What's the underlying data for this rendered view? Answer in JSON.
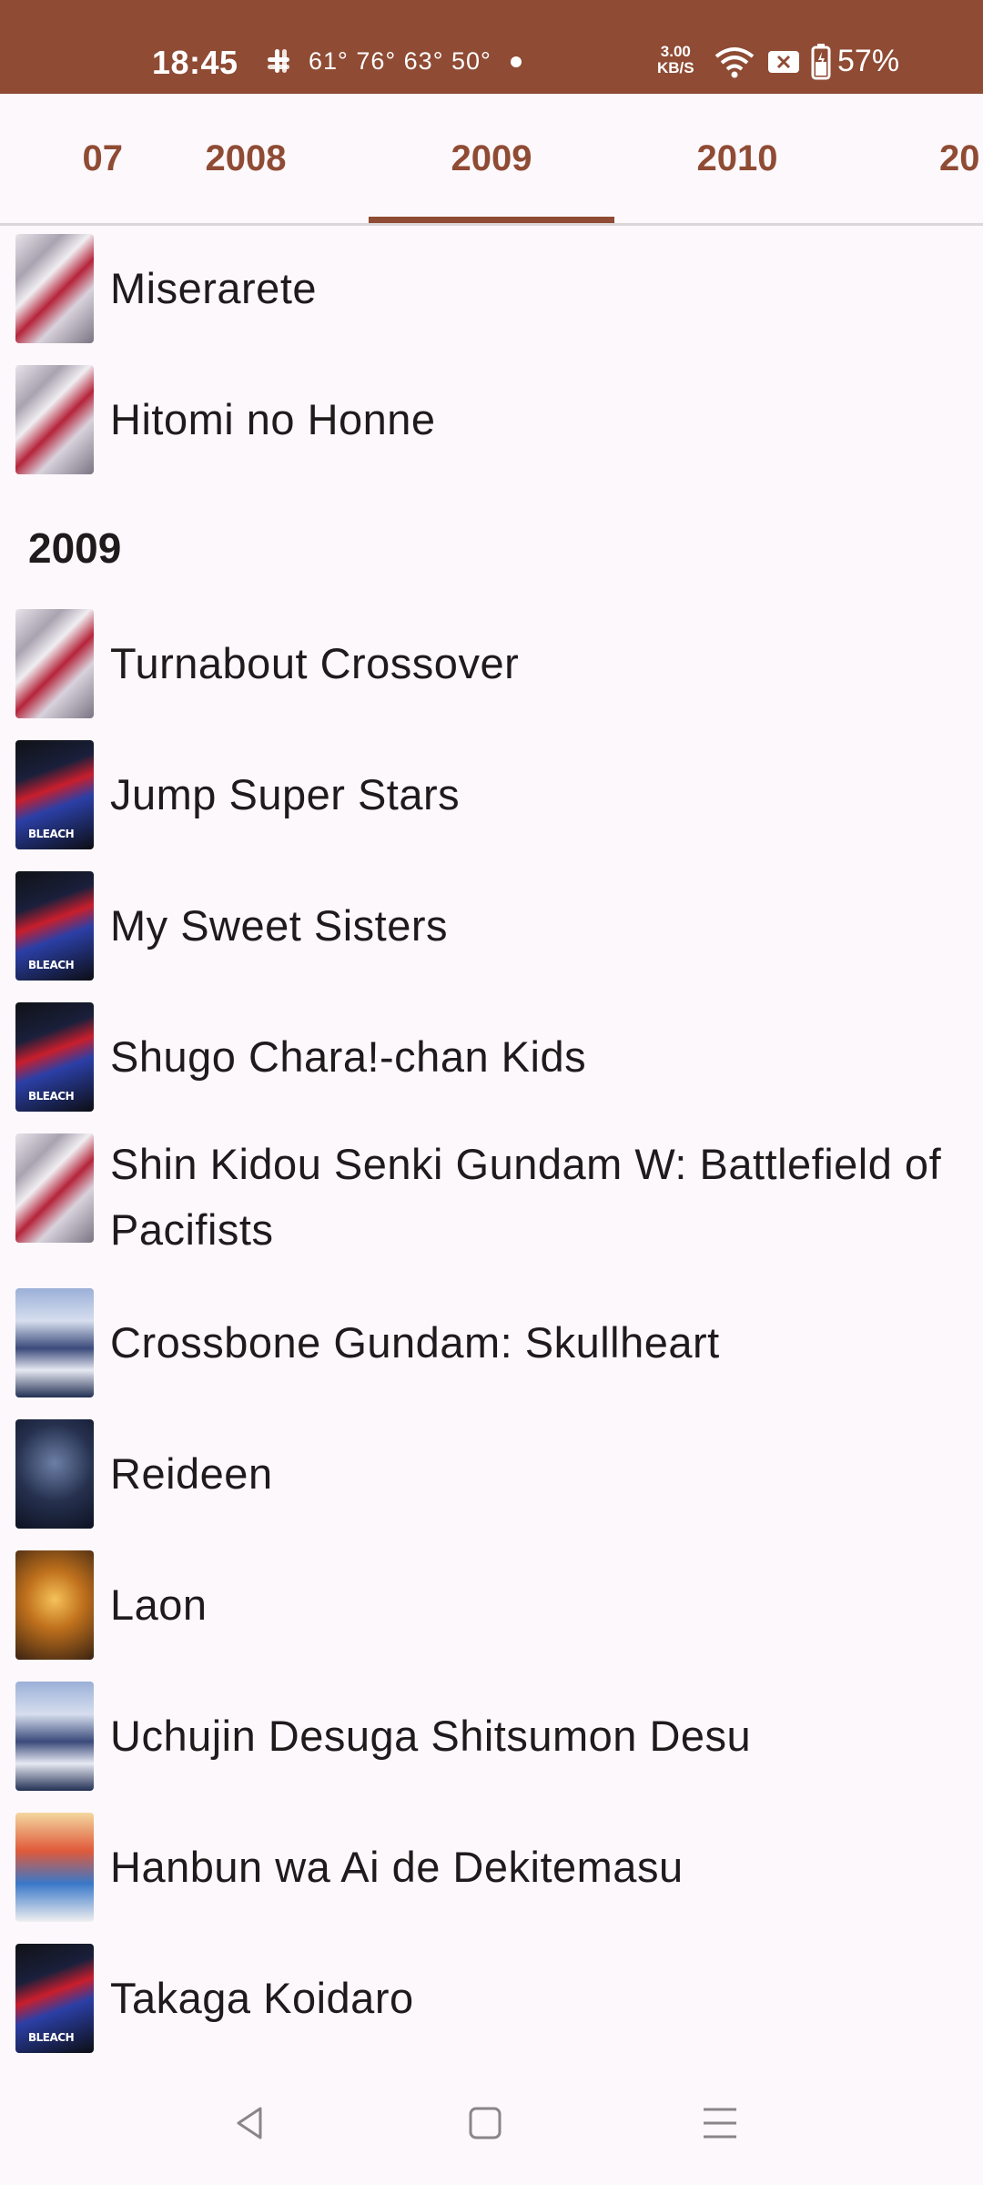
{
  "status_bar": {
    "time": "18:45",
    "temps": "61° 76° 63° 50°",
    "speed_value": "3.00",
    "speed_unit": "KB/S",
    "battery": "57%"
  },
  "tabs": [
    {
      "label": "07"
    },
    {
      "label": "2008"
    },
    {
      "label": "2009"
    },
    {
      "label": "2010"
    },
    {
      "label": "20"
    }
  ],
  "selected_tab": "2009",
  "list": {
    "items_top": [
      {
        "title": "Miserarete",
        "cover": "pale-collage-cover"
      },
      {
        "title": "Hitomi no Honne",
        "cover": "pale-collage-cover"
      }
    ],
    "section_header": "2009",
    "items": [
      {
        "title": "Turnabout Crossover",
        "cover": "pale-collage-cover"
      },
      {
        "title": "Jump Super Stars",
        "cover": "bleach-cover"
      },
      {
        "title": "My Sweet Sisters",
        "cover": "bleach-cover"
      },
      {
        "title": "Shugo Chara!-chan Kids",
        "cover": "bleach-cover"
      },
      {
        "title": "Shin Kidou Senki Gundam W: Battlefield of Pacifists",
        "cover": "pale-collage-cover"
      },
      {
        "title": "Crossbone Gundam: Skullheart",
        "cover": "blue-group-cover"
      },
      {
        "title": "Reideen",
        "cover": "dark-blue-cover"
      },
      {
        "title": "Laon",
        "cover": "orange-fire-cover"
      },
      {
        "title": "Uchujin Desuga Shitsumon Desu",
        "cover": "blue-group-cover"
      },
      {
        "title": "Hanbun wa Ai de Dekitemasu",
        "cover": "one-piece-cover"
      },
      {
        "title": "Takaga Koidaro",
        "cover": "bleach-cover"
      }
    ],
    "bleach_cover_text": "BLEACH"
  },
  "colors": {
    "accent": "#8f4b34",
    "background": "#fdf8fb",
    "text": "#1f1a1c"
  }
}
